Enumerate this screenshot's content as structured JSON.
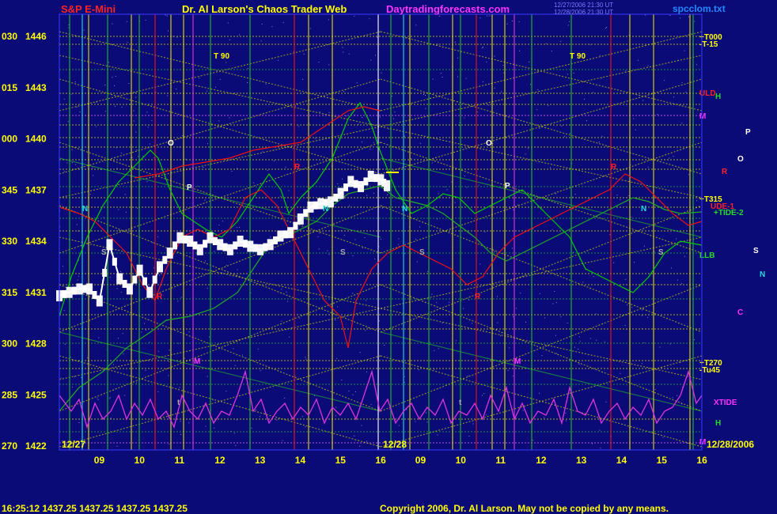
{
  "header": {
    "instrument": "S&P E-Mini",
    "title": "Dr. Al Larson's Chaos Trader Web",
    "site": "Daytradingforecasts.com",
    "timestamp_1": "12/27/2006 21:30 UT",
    "timestamp_2": "12/28/2006 21:30 UT",
    "file": "spcclom.txt"
  },
  "footer": {
    "quote": "16:25:12  1437.25  1437.25  1437.25  1437.25",
    "copyright": "Copyright 2006, Dr. Al Larson. May not be copied by any means."
  },
  "colors": {
    "background": "#0b0b78",
    "price_bars": "#ffffff",
    "green_line": "#00cc00",
    "red_line": "#ee1111",
    "magenta_line": "#dd33dd",
    "grid_yellow": "#dddd00",
    "grid_green": "#22bb22",
    "text_yellow": "#ffff00",
    "text_red": "#ff2222",
    "text_magenta": "#ff33ff"
  },
  "chart_data": {
    "type": "line",
    "title": "S&P E-Mini",
    "y_axis_labels": [
      {
        "code": "030",
        "price": 1446
      },
      {
        "code": "015",
        "price": 1443
      },
      {
        "code": "000",
        "price": 1440
      },
      {
        "code": "345",
        "price": 1437
      },
      {
        "code": "330",
        "price": 1434
      },
      {
        "code": "315",
        "price": 1431
      },
      {
        "code": "300",
        "price": 1428
      },
      {
        "code": "285",
        "price": 1425
      },
      {
        "code": "270",
        "price": 1422
      }
    ],
    "ylim": [
      1422,
      1446.5
    ],
    "x_ticks_day1": [
      "09",
      "10",
      "11",
      "12",
      "13",
      "14",
      "15",
      "16"
    ],
    "x_ticks_day2": [
      "09",
      "10",
      "11",
      "12",
      "13",
      "14",
      "15",
      "16"
    ],
    "dates": [
      "12/27",
      "12/28",
      "12/28/2006"
    ],
    "price_series": {
      "name": "S&P E-Mini price",
      "x_hours": [
        8.0,
        8.25,
        8.5,
        8.75,
        9.0,
        9.25,
        9.5,
        9.75,
        10.0,
        10.25,
        10.5,
        10.75,
        11.0,
        11.25,
        11.5,
        11.75,
        12.0,
        12.25,
        12.5,
        12.75,
        13.0,
        13.25,
        13.5,
        13.75,
        14.0,
        14.25,
        14.5,
        14.75,
        15.0,
        15.25,
        15.5,
        15.75,
        16.0,
        16.15
      ],
      "close": [
        1430.8,
        1431.0,
        1431.2,
        1431.2,
        1430.5,
        1433.8,
        1431.8,
        1431.2,
        1432.3,
        1431.0,
        1432.5,
        1433.3,
        1434.2,
        1434.0,
        1433.5,
        1434.2,
        1433.8,
        1433.5,
        1434.0,
        1433.7,
        1433.5,
        1433.8,
        1434.3,
        1434.5,
        1435.3,
        1436.0,
        1436.2,
        1436.3,
        1436.8,
        1437.5,
        1437.2,
        1437.8,
        1437.6,
        1437.25
      ]
    },
    "annotations": [
      "T 90",
      "O",
      "P",
      "N",
      "S",
      "R",
      "M",
      "C",
      "t",
      "+T000",
      "-T-15",
      "ULD",
      "H",
      "+T315",
      "UDE-1",
      "+TIDE-2",
      "LLB",
      "+T270",
      "-Tu45",
      "XTIDE"
    ],
    "grid": true
  }
}
